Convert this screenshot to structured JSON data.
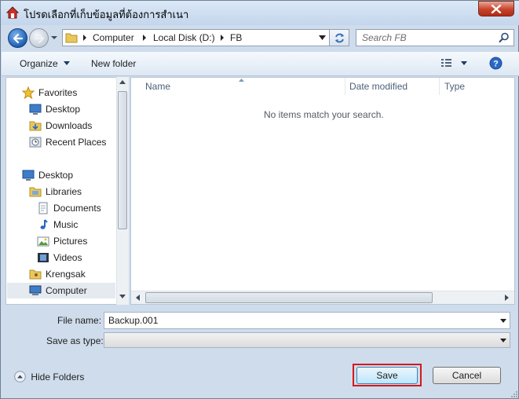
{
  "window": {
    "title": "โปรดเลือกที่เก็บข้อมูลที่ต้องการสำเนา"
  },
  "address": {
    "crumbs": [
      "Computer",
      "Local Disk (D:)",
      "FB"
    ]
  },
  "search": {
    "placeholder": "Search FB"
  },
  "toolbar": {
    "organize_label": "Organize",
    "new_folder_label": "New folder"
  },
  "sidebar": {
    "items": [
      {
        "label": "Favorites",
        "icon": "star-icon"
      },
      {
        "label": "Desktop",
        "icon": "desktop-icon"
      },
      {
        "label": "Downloads",
        "icon": "downloads-icon"
      },
      {
        "label": "Recent Places",
        "icon": "recent-places-icon"
      },
      {
        "label": "Desktop",
        "icon": "desktop-icon"
      },
      {
        "label": "Libraries",
        "icon": "libraries-icon"
      },
      {
        "label": "Documents",
        "icon": "documents-icon"
      },
      {
        "label": "Music",
        "icon": "music-icon"
      },
      {
        "label": "Pictures",
        "icon": "pictures-icon"
      },
      {
        "label": "Videos",
        "icon": "videos-icon"
      },
      {
        "label": "Krengsak",
        "icon": "user-folder-icon"
      },
      {
        "label": "Computer",
        "icon": "computer-icon"
      }
    ]
  },
  "files": {
    "columns": [
      "Name",
      "Date modified",
      "Type"
    ],
    "empty_message": "No items match your search."
  },
  "form": {
    "file_name_label": "File name:",
    "file_name_value": "Backup.001",
    "save_type_label": "Save as type:",
    "save_type_value": ""
  },
  "footer": {
    "hide_folders_label": "Hide Folders",
    "save_label": "Save",
    "cancel_label": "Cancel",
    "highlight_color": "#d41a1a"
  }
}
